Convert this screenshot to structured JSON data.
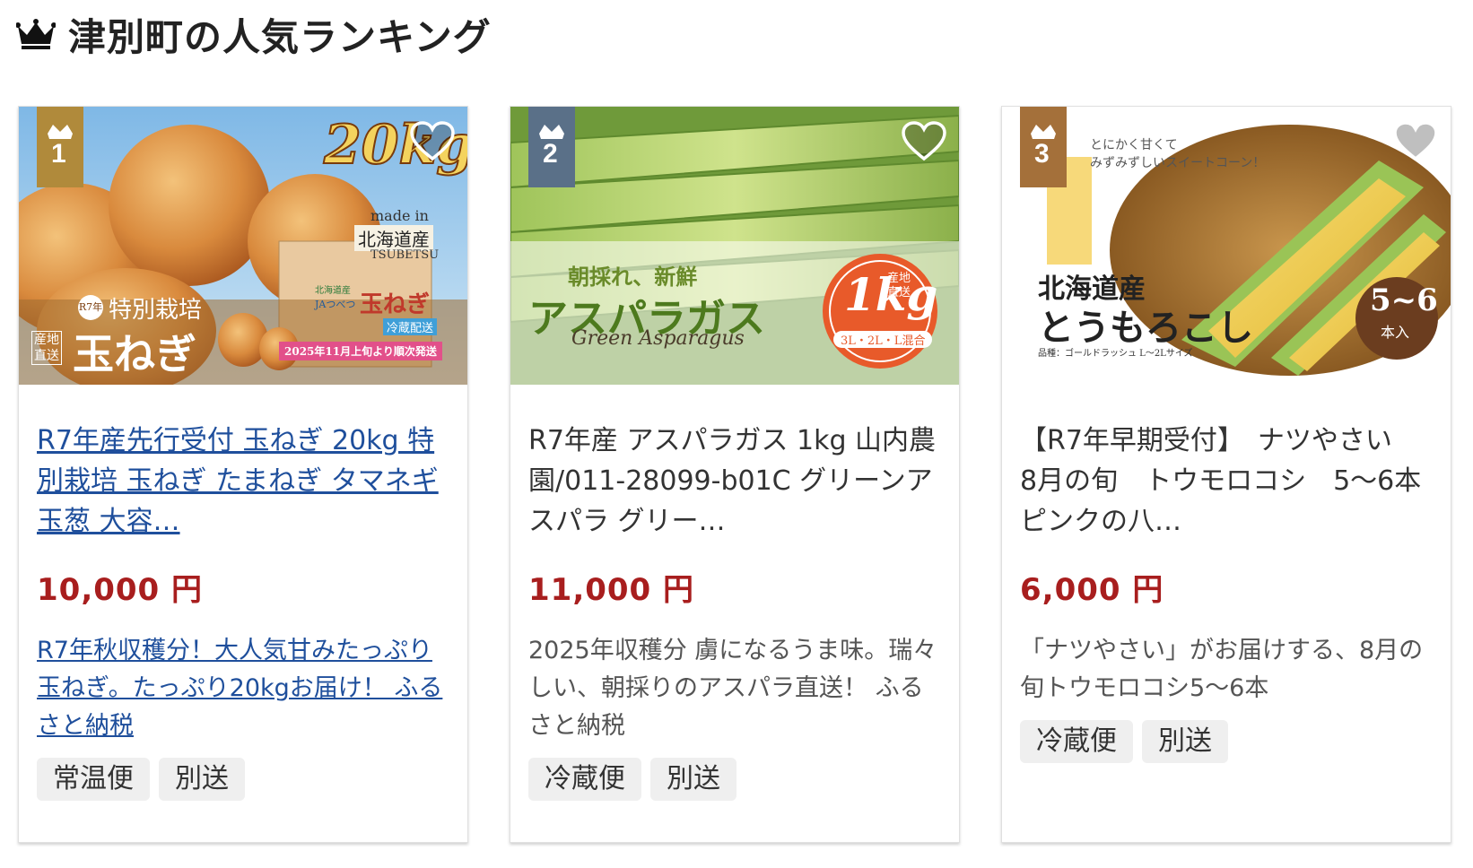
{
  "header": {
    "title": "津別町の人気ランキング"
  },
  "cards": [
    {
      "rank": "1",
      "rank_color": "#b08a3b",
      "image_texts": [
        "20kg",
        "made in",
        "北海道産",
        "TSUBETSU",
        "特別栽培",
        "R7年産",
        "産地直送",
        "玉ねぎ",
        "冷蔵配送",
        "2025年11月上旬より順次発送",
        "JAつべつ",
        "北海道産",
        "玉ねぎ"
      ],
      "name": "R7年産先行受付 玉ねぎ 20kg 特別栽培 玉ねぎ たまねぎ タマネギ 玉葱 大容…",
      "price": "10,000 円",
      "description": "R7年秋収穫分！大人気甘みたっぷり玉ねぎ。たっぷり20kgお届け！ ふるさと納税",
      "tags": [
        "常温便",
        "別送"
      ]
    },
    {
      "rank": "2",
      "rank_color": "#5a7088",
      "image_texts": [
        "朝採れ、新鮮",
        "アスパラガス",
        "Green Asparagus",
        "1kg",
        "産地直送",
        "3L・2L・L混合"
      ],
      "name": "R7年産 アスパラガス 1kg 山内農園/011-28099-b01C グリーンアスパラ グリー…",
      "price": "11,000 円",
      "description": "2025年収穫分 虜になるうま味。瑞々しい、朝採りのアスパラ直送！ ふるさと納税",
      "tags": [
        "冷蔵便",
        "別送"
      ]
    },
    {
      "rank": "3",
      "rank_color": "#a4703a",
      "image_texts": [
        "とにかく甘くて",
        "みずみずしいスイートコーン！",
        "北海道産",
        "とうもろこし",
        "品種：ゴールドラッシュ L〜2Lサイズ",
        "5~6",
        "本入"
      ],
      "name": "【R7年早期受付】　ナツやさい　8月の旬　トウモロコシ　5〜6本　ピンクの八…",
      "price": "6,000 円",
      "description": "「ナツやさい」がお届けする、8月の旬トウモロコシ5〜6本",
      "tags": [
        "冷蔵便",
        "別送"
      ]
    }
  ]
}
